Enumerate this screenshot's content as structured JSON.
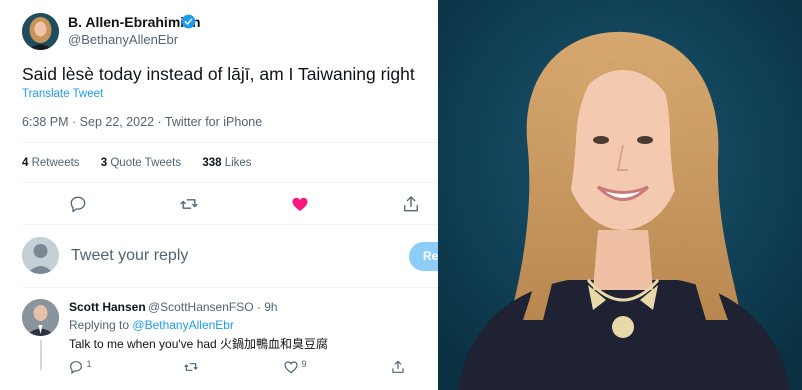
{
  "tweet": {
    "author_name": "B. Allen-Ebrahimian",
    "author_handle": "@BethanyAllenEbr",
    "text": "Said lèsè today instead of lājī, am I Taiwaning right",
    "translate_label": "Translate Tweet",
    "meta": "6:38 PM · Sep 22, 2022 · Twitter for iPhone",
    "stats": {
      "retweets_count": "4",
      "retweets_label": "Retweets",
      "quotes_count": "3",
      "quotes_label": "Quote Tweets",
      "likes_count": "338",
      "likes_label": "Likes"
    },
    "actions": [
      "reply-icon",
      "retweet-icon",
      "like-icon",
      "share-icon"
    ],
    "liked_color": "#f91880"
  },
  "compose": {
    "placeholder": "Tweet your reply",
    "button_label": "Reply"
  },
  "reply": {
    "author_name": "Scott Hansen",
    "handle_time": "@ScottHansenFSO · 9h",
    "replying_prefix": "Replying to",
    "replying_to": "@BethanyAllenEbr",
    "text": "Talk to me when you've had 火鍋加鴨血和臭豆腐",
    "reply_count": "1",
    "like_count": "9"
  },
  "colors": {
    "accent": "#1d9bf0",
    "photo_background": "#0d3b52"
  }
}
